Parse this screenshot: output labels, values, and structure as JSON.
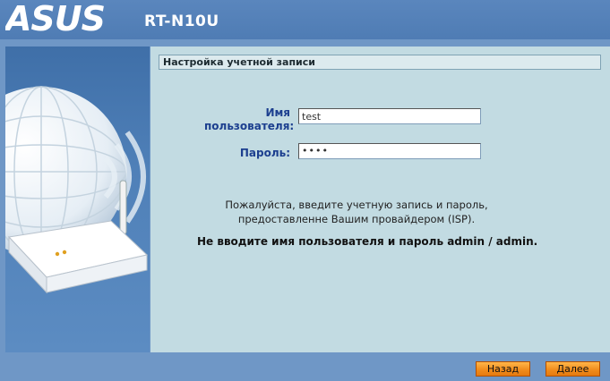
{
  "header": {
    "brand": "ASUS",
    "model": "RT-N10U"
  },
  "form": {
    "section_title": "Настройка учетной записи",
    "username_label_line1": "Имя",
    "username_label_line2": "пользователя:",
    "username_value": "test",
    "password_label": "Пароль:",
    "password_value": "••••"
  },
  "notes": {
    "line1": "Пожалуйста, введите учетную запись и пароль,",
    "line2": "предоставленне Вашим провайдером (ISP).",
    "warning": "Не вводите имя пользователя и пароль admin / admin."
  },
  "buttons": {
    "back": "Назад",
    "next": "Далее"
  },
  "colors": {
    "background": "#6f97c6",
    "content_bg": "#c2dbe2",
    "label": "#1c3f8f",
    "button": "#f08a1a"
  }
}
